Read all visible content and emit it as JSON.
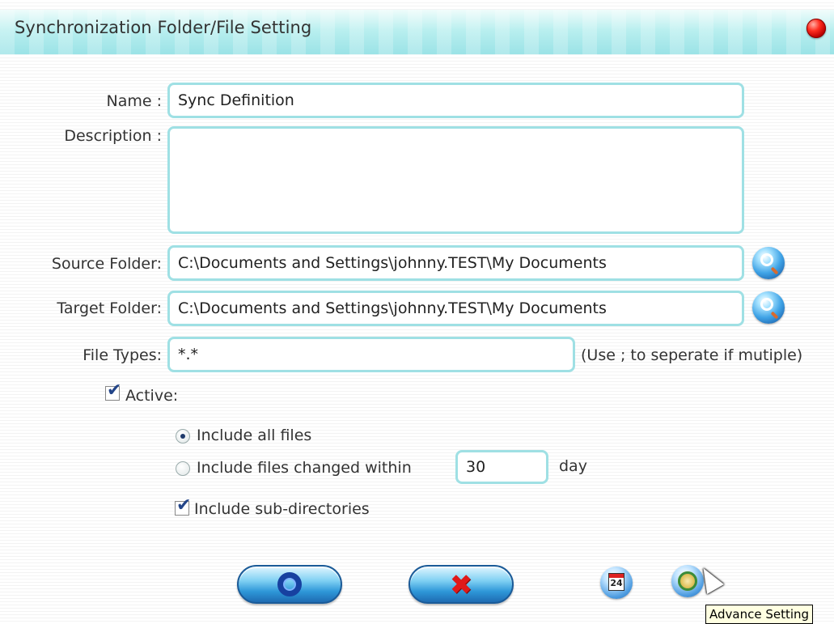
{
  "window": {
    "title": "Synchronization Folder/File Setting"
  },
  "form": {
    "name_label": "Name :",
    "name_value": "Sync Definition",
    "description_label": "Description :",
    "description_value": "",
    "source_label": "Source Folder:",
    "source_value": "C:\\Documents and Settings\\johnny.TEST\\My Documents",
    "target_label": "Target Folder:",
    "target_value": "C:\\Documents and Settings\\johnny.TEST\\My Documents",
    "filetypes_label": "File Types:",
    "filetypes_value": "*.*",
    "filetypes_hint": "(Use ; to seperate if mutiple)",
    "active_label": "Active:",
    "active_checked": true,
    "include_all_label": "Include all files",
    "include_all_selected": true,
    "include_changed_label": "Include files changed within",
    "include_changed_selected": false,
    "days_value": "30",
    "days_unit": "day",
    "include_subdirs_label": "Include sub-directories",
    "include_subdirs_checked": true
  },
  "buttons": {
    "ok_icon": "ok-circle-icon",
    "cancel_icon": "red-x-icon",
    "schedule_icon": "calendar-icon",
    "calendar_day": "24",
    "advance_icon": "gear-icon"
  },
  "tooltip": {
    "text": "Advance Setting"
  },
  "colors": {
    "field_border": "#9fe0e4",
    "title_bar": "#b9efef",
    "close": "#ff2d20"
  }
}
